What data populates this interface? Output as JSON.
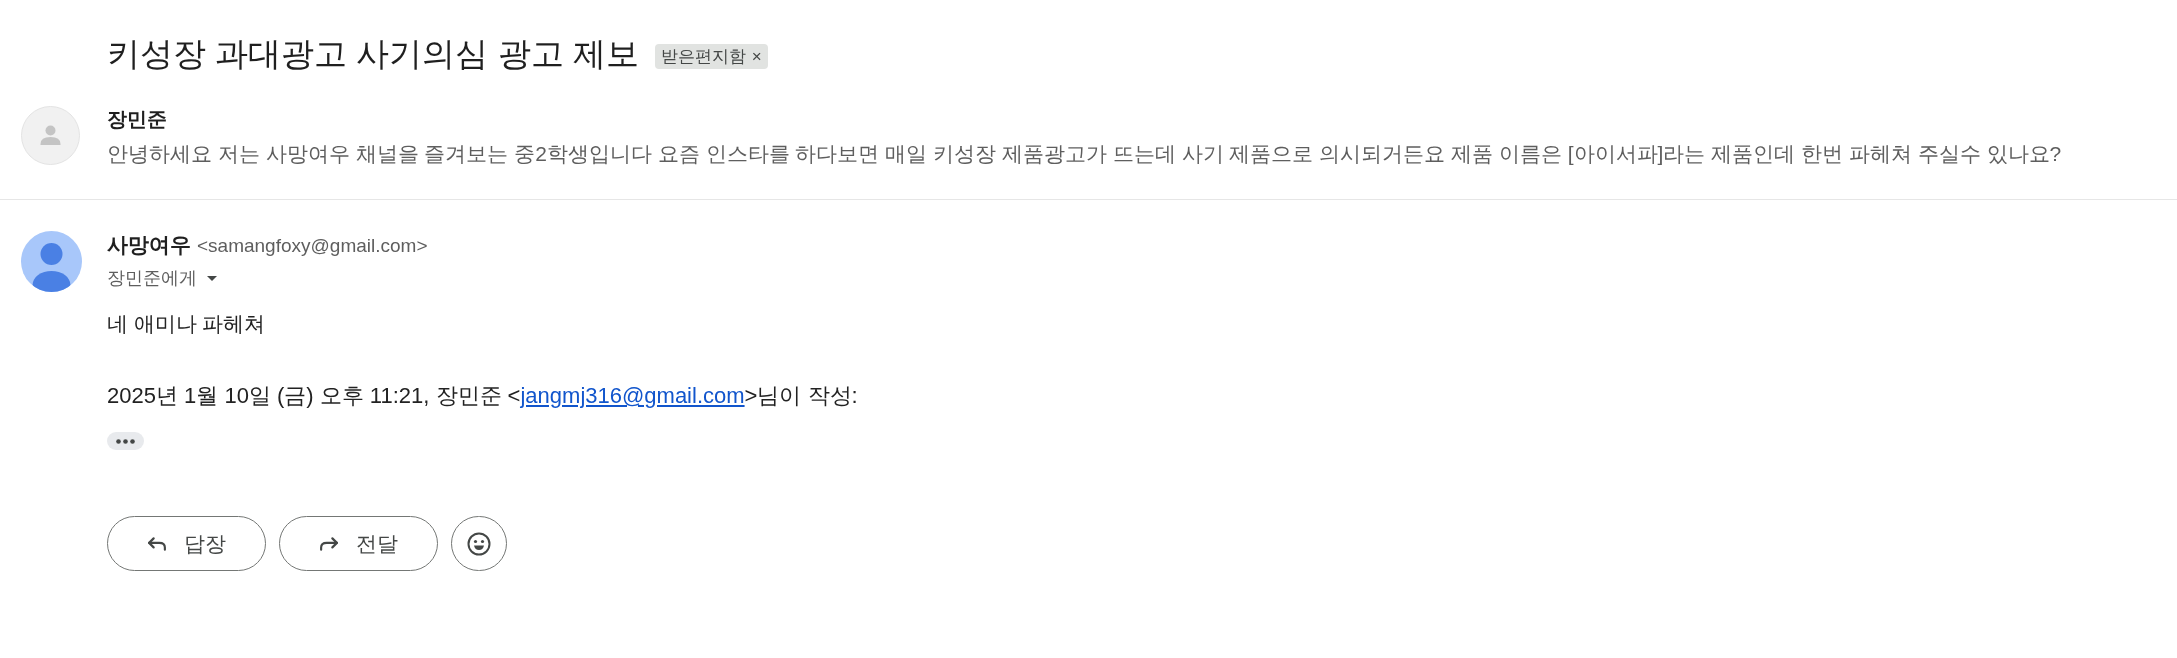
{
  "thread": {
    "subject": "키성장 과대광고 사기의심 광고 제보",
    "label": {
      "text": "받은편지함",
      "remove": "×"
    }
  },
  "messages": [
    {
      "kind": "collapsed",
      "sender": "장민준",
      "snippet": "안녕하세요 저는 사망여우 채널을 즐겨보는 중2학생입니다 요즘 인스타를 하다보면 매일 키성장 제품광고가 뜨는데 사기 제품으로 의시되거든요 제품 이름은 [아이서파]라는 제품인데 한번 파헤쳐 주실수 있나요?"
    },
    {
      "kind": "expanded",
      "sender": "사망여우",
      "email": "<samangfoxy@gmail.com>",
      "recipient": "장민준에게",
      "body": "네 애미나 파헤쳐",
      "quote_header": {
        "before": "2025년 1월 10일 (금) 오후 11:21, 장민준 <",
        "link": "jangmj316@gmail.com",
        "after": ">님이 작성:"
      }
    }
  ],
  "actions": [
    {
      "kind": "reply",
      "label": "답장"
    },
    {
      "kind": "forward",
      "label": "전달"
    },
    {
      "kind": "emoji"
    }
  ]
}
